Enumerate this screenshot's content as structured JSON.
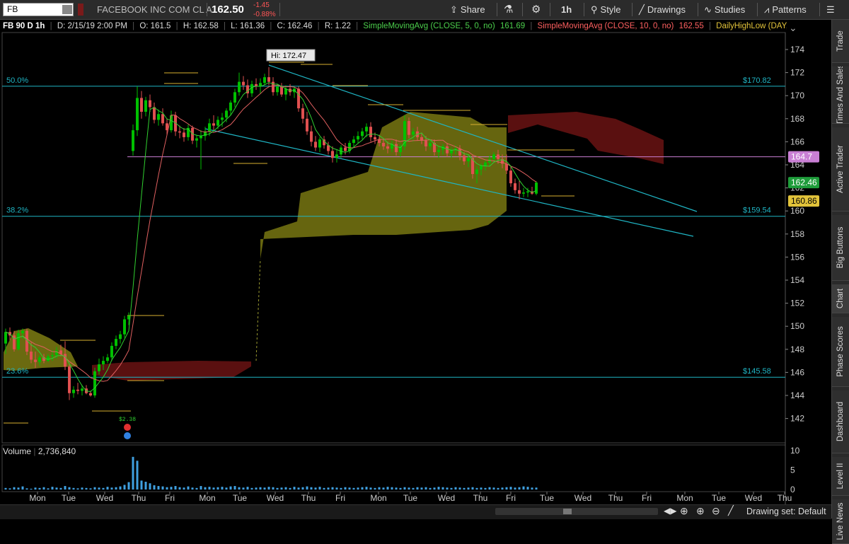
{
  "toolbar": {
    "symbol": "FB",
    "description": "FACEBOOK INC COM CL A",
    "last_price": "162.50",
    "net_change": "-1.45",
    "pct_change": "-0.88%",
    "share_label": "Share",
    "interval_label": "1h",
    "style_label": "Style",
    "drawings_label": "Drawings",
    "studies_label": "Studies",
    "patterns_label": "Patterns"
  },
  "studybar": {
    "header": "FB 90 D 1h",
    "date": "D: 2/15/19 2:00 PM",
    "open": "O: 161.5",
    "high": "H: 162.58",
    "low": "L: 161.36",
    "close": "C: 162.46",
    "range": "R: 1.22",
    "sma5_label": "SimpleMovingAvg (CLOSE, 5, 0, no)",
    "sma5_value": "161.69",
    "sma10_label": "SimpleMovingAvg (CLOSE, 10, 0, no)",
    "sma10_value": "162.55",
    "dhl_label": "DailyHighLow (DAY, 1, -1,..."
  },
  "sidebar": {
    "tabs": [
      "Trade",
      "Times And Sales",
      "Active Trader",
      "Big Buttons",
      "Chart",
      "Phase Scores",
      "Dashboard",
      "Level II",
      "Live News"
    ]
  },
  "chart": {
    "price_axis": [
      "174",
      "172",
      "170",
      "168",
      "166",
      "164",
      "162",
      "160",
      "158",
      "156",
      "154",
      "152",
      "150",
      "148",
      "146",
      "144",
      "142"
    ],
    "price_badges": [
      {
        "label": "164.7",
        "color": "#ffffff",
        "bg": "#c97fd4"
      },
      {
        "label": "162.46",
        "color": "#ffffff",
        "bg": "#1e9c3a"
      },
      {
        "label": "160.86",
        "color": "#000000",
        "bg": "#e2c33a"
      }
    ],
    "fib_levels": [
      {
        "pct": "50.0%",
        "price": "$170.82"
      },
      {
        "pct": "38.2%",
        "price": "$159.54"
      },
      {
        "pct": "23.6%",
        "price": "$145.58"
      }
    ],
    "hi_label": "Hi: 172.47",
    "dividend_label": "$2.38",
    "x_axis": [
      "Mon",
      "Tue",
      "Wed",
      "Thu",
      "Fri",
      "Mon",
      "Tue",
      "Wed",
      "Thu",
      "Fri",
      "Mon",
      "Tue",
      "Wed",
      "Thu",
      "Fri",
      "Tue",
      "Wed",
      "Thu",
      "Fri",
      "Mon",
      "Tue",
      "Wed",
      "Thu"
    ],
    "accent_up": "#00c000",
    "accent_down": "#e05050",
    "fib_color": "#1fb5c4"
  },
  "volume": {
    "label": "Volume",
    "value": "2,736,840",
    "axis": [
      "10",
      "5",
      "0"
    ],
    "unit": "<milli..."
  },
  "bottombar": {
    "drawing_set": "Drawing set: Default"
  }
}
